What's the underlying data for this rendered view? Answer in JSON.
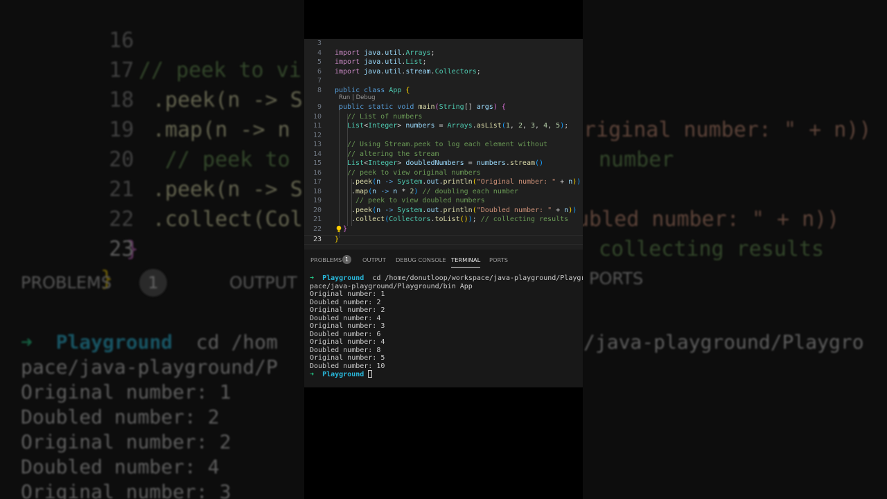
{
  "editor": {
    "codelens": "Run | Debug",
    "active_line": "23",
    "lines": [
      {
        "num": "3",
        "code": ""
      },
      {
        "num": "4",
        "code": "import java.util.Arrays;"
      },
      {
        "num": "5",
        "code": "import java.util.List;"
      },
      {
        "num": "6",
        "code": "import java.util.stream.Collectors;"
      },
      {
        "num": "7",
        "code": ""
      },
      {
        "num": "8",
        "code": "public class App {"
      },
      {
        "num": "9",
        "code": "public static void main(String[] args) {"
      },
      {
        "num": "10",
        "code": "// List of numbers"
      },
      {
        "num": "11",
        "code": "List<Integer> numbers = Arrays.asList(1, 2, 3, 4, 5);"
      },
      {
        "num": "12",
        "code": ""
      },
      {
        "num": "13",
        "code": "// Using Stream.peek to log each element without"
      },
      {
        "num": "14",
        "code": "// altering the stream"
      },
      {
        "num": "15",
        "code": "List<Integer> doubledNumbers = numbers.stream()"
      },
      {
        "num": "16",
        "code": "// peek to view original numbers"
      },
      {
        "num": "17",
        "code": ".peek(n -> System.out.println(\"Original number: \" + n))"
      },
      {
        "num": "18",
        "code": ".map(n -> n * 2) // doubling each number"
      },
      {
        "num": "19",
        "code": "// peek to view doubled numbers"
      },
      {
        "num": "20",
        "code": ".peek(n -> System.out.println(\"Doubled number: \" + n))"
      },
      {
        "num": "21",
        "code": ".collect(Collectors.toList()); // collecting results"
      },
      {
        "num": "22",
        "code": "}"
      },
      {
        "num": "23",
        "code": "}"
      }
    ]
  },
  "panel": {
    "tabs": [
      "PROBLEMS",
      "OUTPUT",
      "DEBUG CONSOLE",
      "TERMINAL",
      "PORTS"
    ],
    "active_tab": "TERMINAL",
    "problems_count": "1"
  },
  "terminal": {
    "prompt_arrow": "➜",
    "prompt_dir": "Playground",
    "command_line_1": " cd /home/donutloop/workspace/java-playground/Playgro",
    "command_line_2": "pace/java-playground/Playground/bin App",
    "output": [
      "Original number: 1",
      "Doubled number: 2",
      "Original number: 2",
      "Doubled number: 4",
      "Original number: 3",
      "Doubled number: 6",
      "Original number: 4",
      "Doubled number: 8",
      "Original number: 5",
      "Doubled number: 10"
    ]
  },
  "background": {
    "code_lines": [
      {
        "num": "16",
        "code": "// peek to vi"
      },
      {
        "num": "17",
        "code": ".peek(n -> S"
      },
      {
        "num": "18",
        "code": ".map(n -> n"
      },
      {
        "num": "19",
        "code": "// peek to"
      },
      {
        "num": "20",
        "code": ".peek(n -> S"
      },
      {
        "num": "21",
        "code": ".collect(Col"
      },
      {
        "num": "22",
        "code": "}"
      },
      {
        "num": "23",
        "code": "}"
      }
    ],
    "right_fragments": [
      "riginal number: \" + n))",
      "number",
      "ubled number: \" + n))",
      "collecting results"
    ],
    "tabs": [
      "PROBLEMS",
      "OUTPUT",
      "D",
      "PORTS"
    ],
    "badge": "1",
    "term_prompt": "Playground",
    "term_cmd": "cd /hom",
    "term_cmd_right": "/java-playground/Playgro",
    "term_line2": "pace/java-playground/P",
    "term_output": [
      "Original number: 1",
      "Doubled number: 2",
      "Original number: 2",
      "Doubled number: 4",
      "Original number: 3"
    ]
  },
  "colors": {
    "editor_bg": "#1f1f1f",
    "panel_bg": "#181818",
    "keyword": "#569cd6",
    "type": "#4ec9b0",
    "comment": "#6a9955",
    "string": "#ce9178",
    "terminal_prompt": "#29b8db"
  }
}
